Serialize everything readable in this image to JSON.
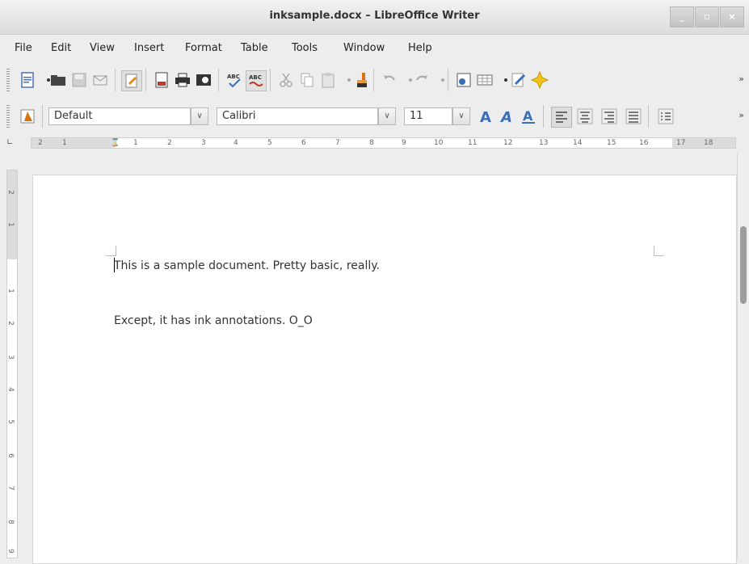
{
  "window": {
    "title": "inksample.docx – LibreOffice Writer",
    "controls": {
      "minimize": "_",
      "maximize": "▫",
      "close": "×"
    }
  },
  "menu": [
    {
      "id": "file",
      "label": "File"
    },
    {
      "id": "edit",
      "label": "Edit"
    },
    {
      "id": "view",
      "label": "View"
    },
    {
      "id": "insert",
      "label": "Insert"
    },
    {
      "id": "format",
      "label": "Format"
    },
    {
      "id": "table",
      "label": "Table"
    },
    {
      "id": "tools",
      "label": "Tools"
    },
    {
      "id": "window",
      "label": "Window"
    },
    {
      "id": "help",
      "label": "Help"
    }
  ],
  "toolbar": {
    "overflow": "»"
  },
  "formatting": {
    "paragraph_style": "Default",
    "font_name": "Calibri",
    "font_size": "11",
    "overflow": "»"
  },
  "ruler": {
    "horizontal": [
      "2",
      "1",
      "1",
      "2",
      "3",
      "4",
      "5",
      "6",
      "7",
      "8",
      "9",
      "10",
      "11",
      "12",
      "13",
      "14",
      "15",
      "16",
      "17",
      "18"
    ],
    "vertical": [
      "2",
      "1",
      "1",
      "2",
      "3",
      "4",
      "5",
      "6",
      "7",
      "8",
      "9"
    ]
  },
  "document": {
    "paragraphs": [
      "This is a sample document.  Pretty basic, really.",
      "Except, it has ink annotations.  O_O"
    ]
  },
  "colors": {
    "accent_blue": "#3a6fb8",
    "document_bg": "#ffffff"
  }
}
